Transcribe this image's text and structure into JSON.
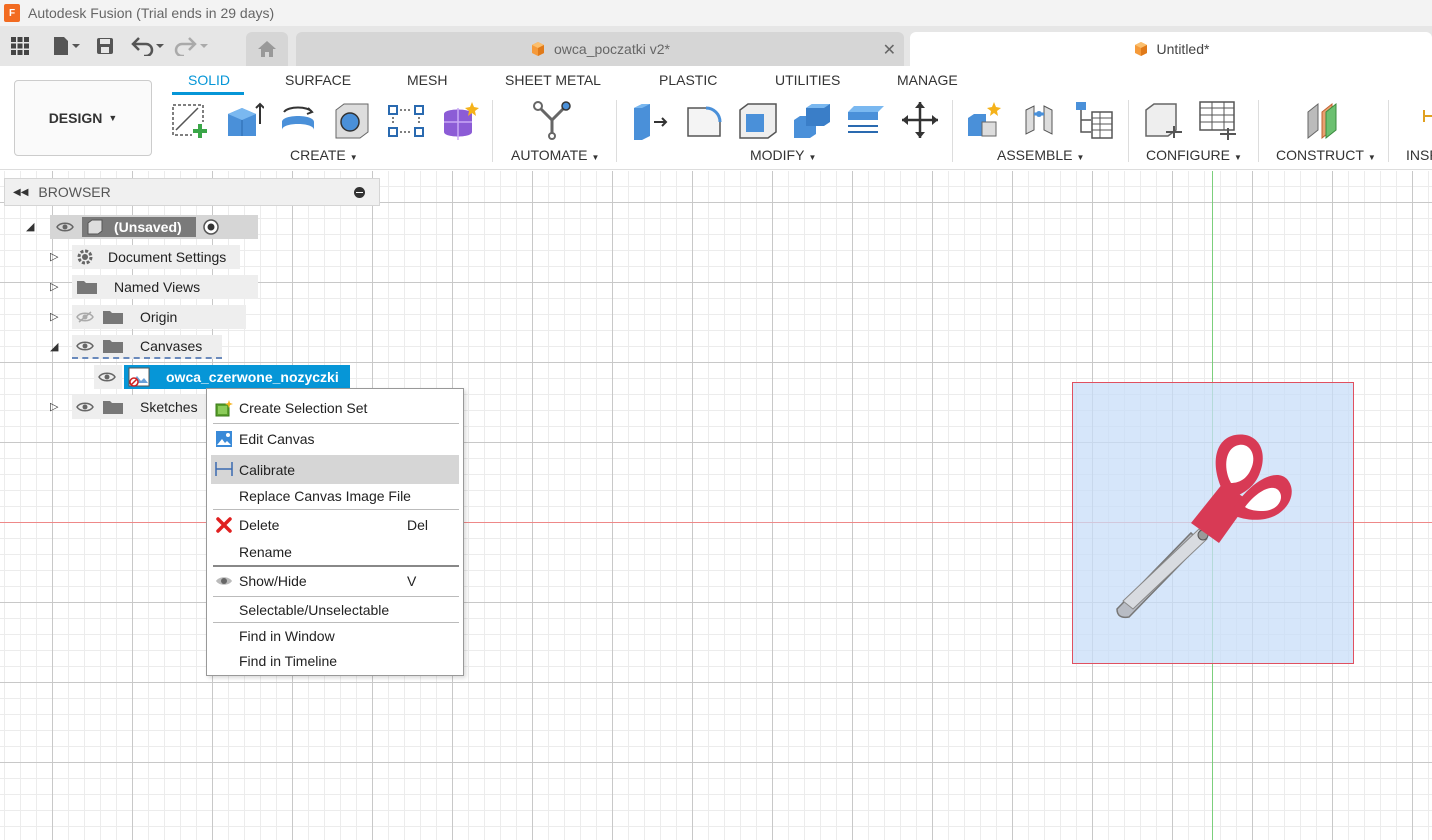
{
  "window": {
    "title": "Autodesk Fusion (Trial ends in 29 days)",
    "logo_letter": "F"
  },
  "tabs": [
    {
      "label": "owca_poczatki v2*",
      "icon": "orange-cube-icon",
      "closable": true,
      "active": false
    },
    {
      "label": "Untitled*",
      "icon": "orange-cube-icon",
      "active": true
    }
  ],
  "ribbon": {
    "workspace": "DESIGN",
    "tabs": [
      "SOLID",
      "SURFACE",
      "MESH",
      "SHEET METAL",
      "PLASTIC",
      "UTILITIES",
      "MANAGE"
    ],
    "active_tab": "SOLID",
    "groups": {
      "create": "CREATE",
      "automate": "AUTOMATE",
      "modify": "MODIFY",
      "assemble": "ASSEMBLE",
      "configure": "CONFIGURE",
      "construct": "CONSTRUCT",
      "inspect": "INSP"
    }
  },
  "browser": {
    "title": "BROWSER",
    "root": "(Unsaved)",
    "items": [
      {
        "label": "Document Settings",
        "icon": "gear-icon"
      },
      {
        "label": "Named Views",
        "icon": "folder-icon"
      },
      {
        "label": "Origin",
        "icon": "folder-icon",
        "hidden": true
      },
      {
        "label": "Canvases",
        "icon": "folder-icon",
        "expanded": true
      },
      {
        "label": "owca_czerwone_nozyczki",
        "icon": "canvas-image-icon",
        "selected": true
      },
      {
        "label": "Sketches",
        "icon": "folder-icon"
      }
    ]
  },
  "context_menu": {
    "items": [
      {
        "label": "Create Selection Set",
        "icon": "selection-set-icon"
      },
      {
        "label": "Edit Canvas",
        "icon": "edit-canvas-icon"
      },
      {
        "label": "Calibrate",
        "icon": "calibrate-icon",
        "hover": true
      },
      {
        "label": "Replace Canvas Image File"
      },
      {
        "label": "Delete",
        "icon": "delete-icon",
        "shortcut": "Del"
      },
      {
        "label": "Rename"
      },
      {
        "label": "Show/Hide",
        "icon": "eye-icon",
        "shortcut": "V"
      },
      {
        "label": "Selectable/Unselectable"
      },
      {
        "label": "Find in Window"
      },
      {
        "label": "Find in Timeline"
      }
    ]
  },
  "colors": {
    "accent": "#0696d7",
    "scissor_handle": "#d83a55",
    "canvas_border": "#e05060",
    "delete_x": "#e02020"
  }
}
